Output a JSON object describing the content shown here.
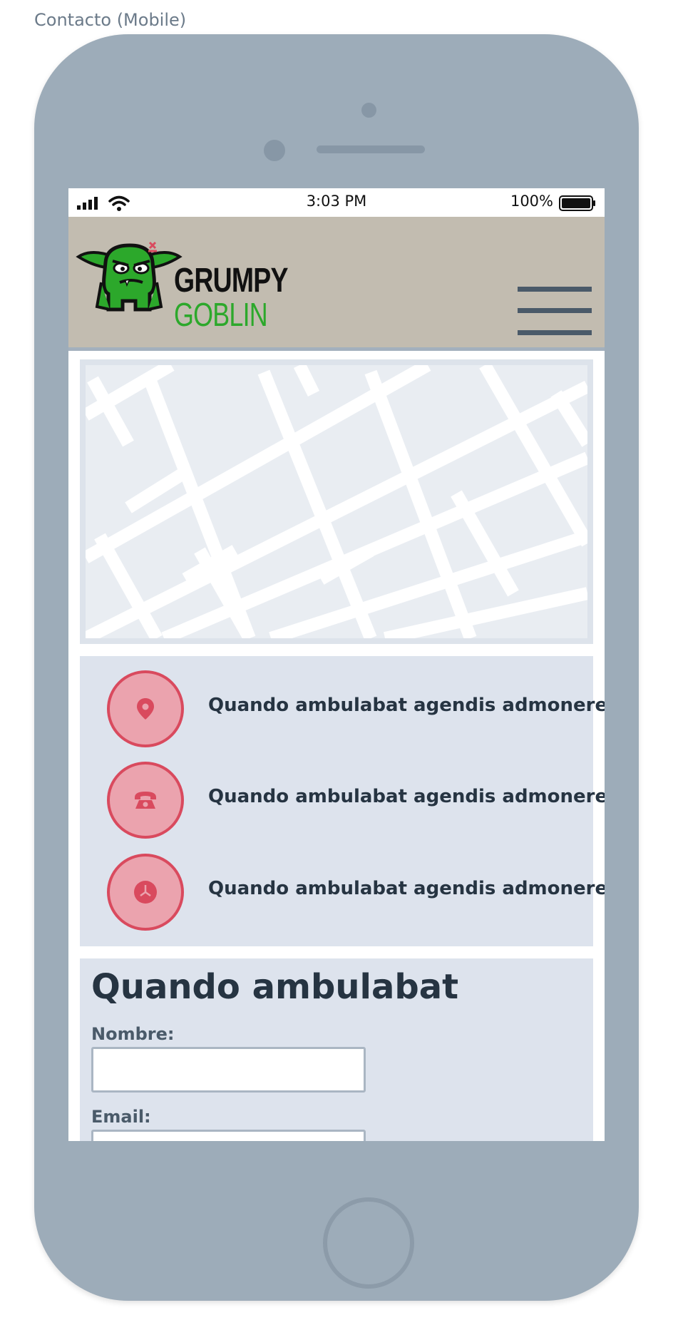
{
  "page_caption": "Contacto (Mobile)",
  "status_bar": {
    "time": "3:03 PM",
    "battery_percent": "100%"
  },
  "header": {
    "brand_line_1": "GRUMPY",
    "brand_line_2": "GOBLIN"
  },
  "contact_info": [
    {
      "icon": "location-pin-icon",
      "text": "Quando ambulabat agendis admonere"
    },
    {
      "icon": "telephone-icon",
      "text": "Quando ambulabat agendis admonere"
    },
    {
      "icon": "clock-icon",
      "text": "Quando ambulabat agendis admonere"
    }
  ],
  "form": {
    "title": "Quando ambulabat",
    "name_label": "Nombre:",
    "name_value": "",
    "email_label": "Email:",
    "email_value": ""
  },
  "colors": {
    "device_frame": "#9dacb9",
    "header_bg": "#c2bcb0",
    "panel_bg": "#dde3ed",
    "icon_circle_fill": "#eba3ae",
    "icon_accent": "#d94a5e",
    "brand_green": "#2ca82b",
    "text_dark": "#263442"
  }
}
